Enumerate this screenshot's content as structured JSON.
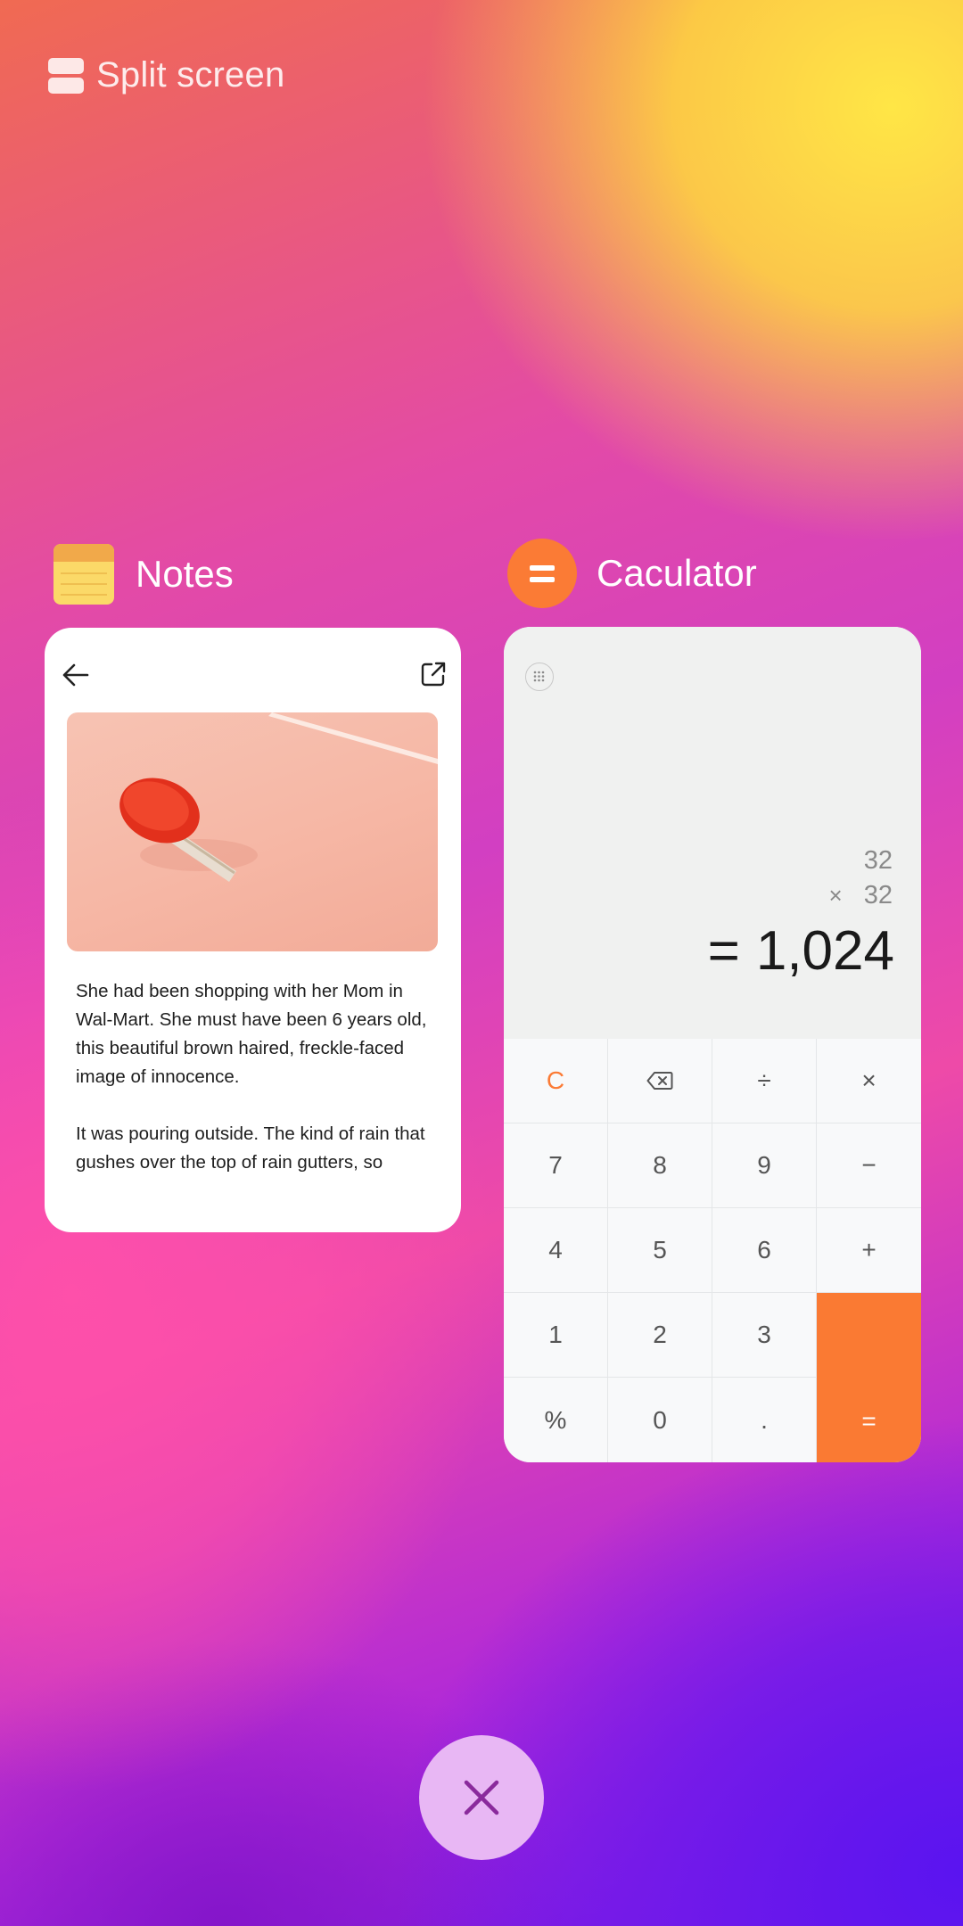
{
  "header": {
    "split_label": "Split screen"
  },
  "notes": {
    "app_label": "Notes",
    "paragraphs": [
      "She had been shopping with her Mom in Wal-Mart. She must have been 6 years old, this beautiful brown haired, freckle-faced image of innocence.",
      "It was pouring outside. The kind of rain that gushes over the top of rain gutters, so"
    ]
  },
  "calculator": {
    "app_label": "Caculator",
    "expr_line1": "32",
    "expr_op": "×",
    "expr_line2": "32",
    "result_eq": "=",
    "result": "1,024",
    "keys": [
      "C",
      "⌫",
      "÷",
      "×",
      "7",
      "8",
      "9",
      "−",
      "4",
      "5",
      "6",
      "+",
      "1",
      "2",
      "3",
      "",
      "%",
      "0",
      ".",
      "="
    ]
  },
  "colors": {
    "accent": "#fb7b35",
    "close_bg": "#e8b7f4",
    "close_x": "#8a2a9c"
  },
  "icons": [
    "split-screen-icon",
    "notes-app-icon",
    "calculator-app-icon",
    "back-arrow-icon",
    "share-icon",
    "menu-icon",
    "backspace-icon",
    "close-icon"
  ]
}
